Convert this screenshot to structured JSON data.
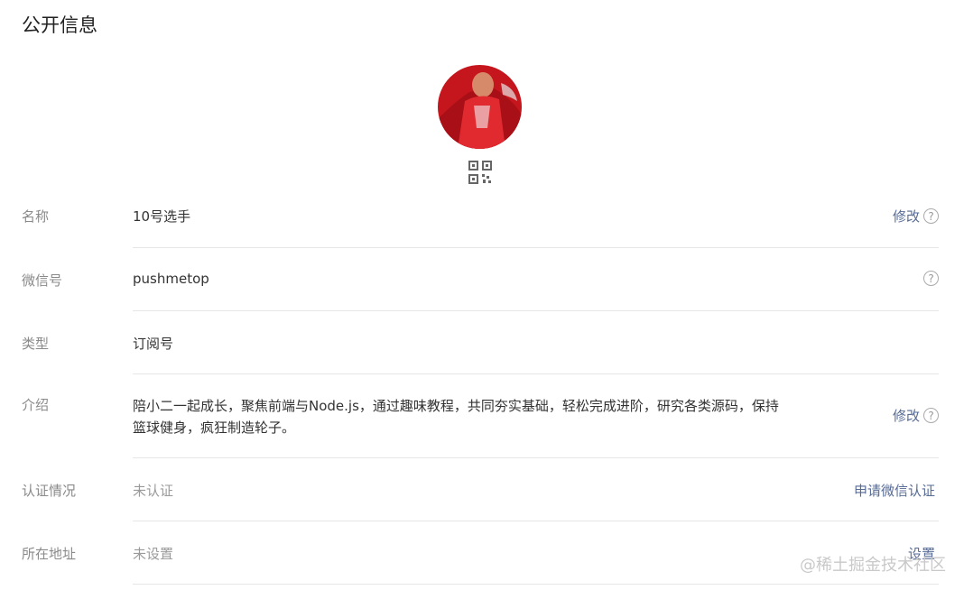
{
  "page": {
    "title": "公开信息"
  },
  "rows": [
    {
      "label": "名称",
      "value": "10号选手",
      "action": "修改"
    },
    {
      "label": "微信号",
      "value": "pushmetop",
      "action": ""
    },
    {
      "label": "类型",
      "value": "订阅号"
    },
    {
      "label": "介绍",
      "value": "陪小二一起成长，聚焦前端与Node.js，通过趣味教程，共同夯实基础，轻松完成进阶，研究各类源码，保持篮球健身，疯狂制造轮子。",
      "action": "修改"
    },
    {
      "label": "认证情况",
      "value": "未认证",
      "action": "申请微信认证"
    },
    {
      "label": "所在地址",
      "value": "未设置",
      "action": "设置"
    }
  ],
  "help_glyph": "?",
  "watermark": "@稀土掘金技术社区",
  "colors": {
    "link": "#576b95",
    "label": "#8a8a8a",
    "divider": "#e6e6e6",
    "avatar_bg": "#c4161c"
  }
}
